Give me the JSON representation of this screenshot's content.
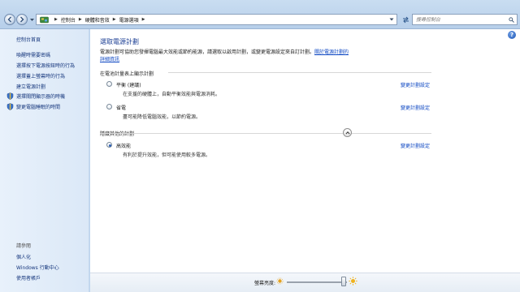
{
  "address": {
    "crumbs": [
      "控制台",
      "硬體和音效",
      "電源選項"
    ],
    "search_placeholder": "搜尋控制台"
  },
  "sidebar": {
    "home": "控制台首頁",
    "links": [
      "喚醒時需要密碼",
      "選擇按下電源按鈕時的行為",
      "選擇蓋上螢幕時的行為",
      "建立電源計劃"
    ],
    "icon_links": [
      "選擇關閉顯示器的時機",
      "變更電腦睡眠的時間"
    ],
    "see_also": "請參閱",
    "see_also_links": [
      "個人化",
      "Windows 行動中心",
      "使用者帳戶"
    ]
  },
  "main": {
    "title": "選取電源計劃",
    "intro": "電源計劃可協助您發揮電腦最大效能或節約能源，請選取以啟用計劃，或變更電源設定來自訂計劃。",
    "intro_link": "關於電源計劃的詳細資訊",
    "section_shown": "在電池計量表上顯示計劃",
    "section_hidden": "隱藏其他的計劃",
    "change_link": "變更計劃設定",
    "plans_shown": [
      {
        "name": "平衡 (建議)",
        "desc": "在支援的硬體上，自動平衡效能與電源消耗。",
        "selected": false
      },
      {
        "name": "省電",
        "desc": "盡可能降低電腦效能，以節約電源。",
        "selected": false
      }
    ],
    "plans_hidden": [
      {
        "name": "高效能",
        "desc": "有利於提升效能，但可能使用較多電源。",
        "selected": true
      }
    ]
  },
  "bottom": {
    "brightness_label": "螢幕亮度:",
    "brightness_level": 0.95
  },
  "colors": {
    "link": "#0c46c2",
    "title": "#1c3f94",
    "sidebar_link": "#16377d"
  }
}
